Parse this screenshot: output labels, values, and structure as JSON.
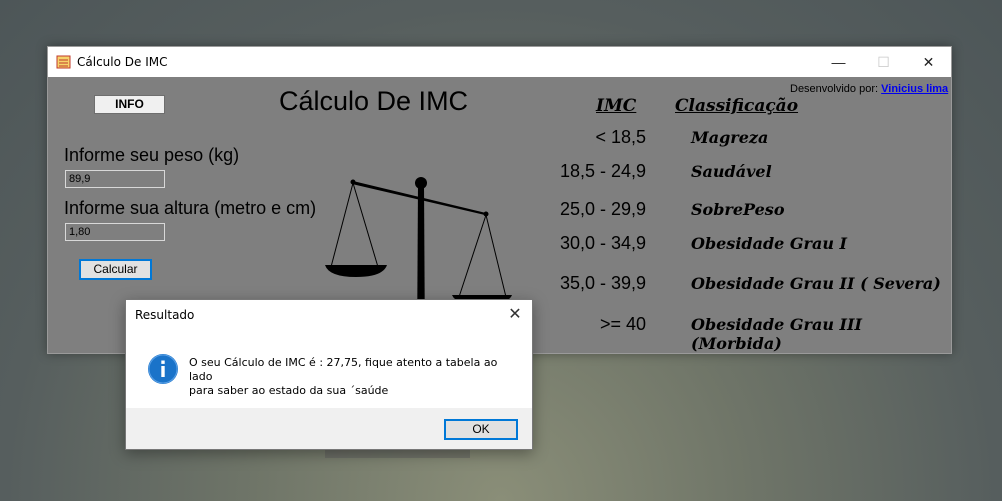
{
  "window": {
    "title": "Cálculo De IMC",
    "controls": {
      "minimize": "—",
      "maximize": "☐",
      "close": "✕"
    }
  },
  "app": {
    "info_button": "INFO",
    "heading": "Cálculo De IMC",
    "developer_label": "Desenvolvido por:",
    "developer_link": "Vinicius lima",
    "peso_label": "Informe seu peso (kg)",
    "peso_value": "89,9",
    "altura_label": "Informe sua altura (metro e cm)",
    "altura_value": "1,80",
    "calcular_button": "Calcular"
  },
  "table": {
    "header_imc": "IMC",
    "header_class": "Classificação",
    "rows": [
      {
        "range": "< 18,5",
        "class": "Magreza"
      },
      {
        "range": "18,5 - 24,9",
        "class": "Saudável"
      },
      {
        "range": "25,0 - 29,9",
        "class": "SobrePeso"
      },
      {
        "range": "30,0 - 34,9",
        "class": "Obesidade Grau I"
      },
      {
        "range": "35,0 - 39,9",
        "class": "Obesidade Grau II ( Severa)"
      },
      {
        "range": ">= 40",
        "class": "Obesidade Grau III (Morbida)"
      }
    ]
  },
  "dialog": {
    "title": "Resultado",
    "close": "✕",
    "message_line1": "O seu Cálculo de IMC é : 27,75, fique atento a tabela ao lado",
    "message_line2": "para saber ao estado da sua ´saúde",
    "ok_button": "OK",
    "icon": "info-icon"
  },
  "colors": {
    "accent": "#0078d7",
    "form_bg": "#7f7f7f",
    "info_icon": "#1a73c9"
  }
}
